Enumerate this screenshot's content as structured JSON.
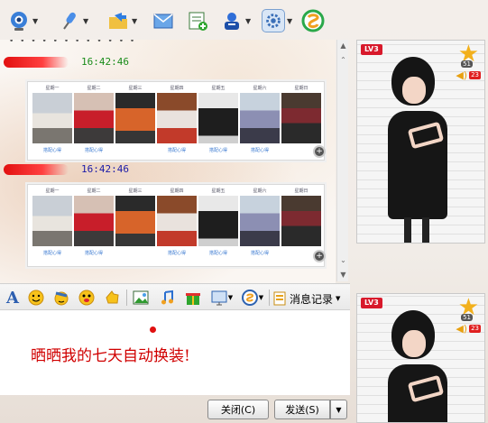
{
  "toolbar": {
    "icons": [
      "webcam-icon",
      "microphone-icon",
      "file-transfer-icon",
      "email-icon",
      "add-app-icon",
      "group-icon",
      "settings-icon",
      "app-logo-icon"
    ]
  },
  "chat": {
    "messages": [
      {
        "time": "16:42:46",
        "time_color": "#1a8c1a"
      },
      {
        "time": "16:42:46",
        "time_color": "#1a1aa8"
      }
    ]
  },
  "format_bar": {
    "history_label": "消息记录"
  },
  "input": {
    "text": "晒晒我的七天自动换装!"
  },
  "buttons": {
    "close_label": "关闭(C)",
    "send_label": "发送(S)"
  },
  "profile": {
    "level_label": "LV3",
    "star_count": "51",
    "volume_count": "23"
  },
  "colors": {
    "input_text": "#d00000",
    "level_badge": "#d8192b",
    "star": "#f2b01c"
  }
}
